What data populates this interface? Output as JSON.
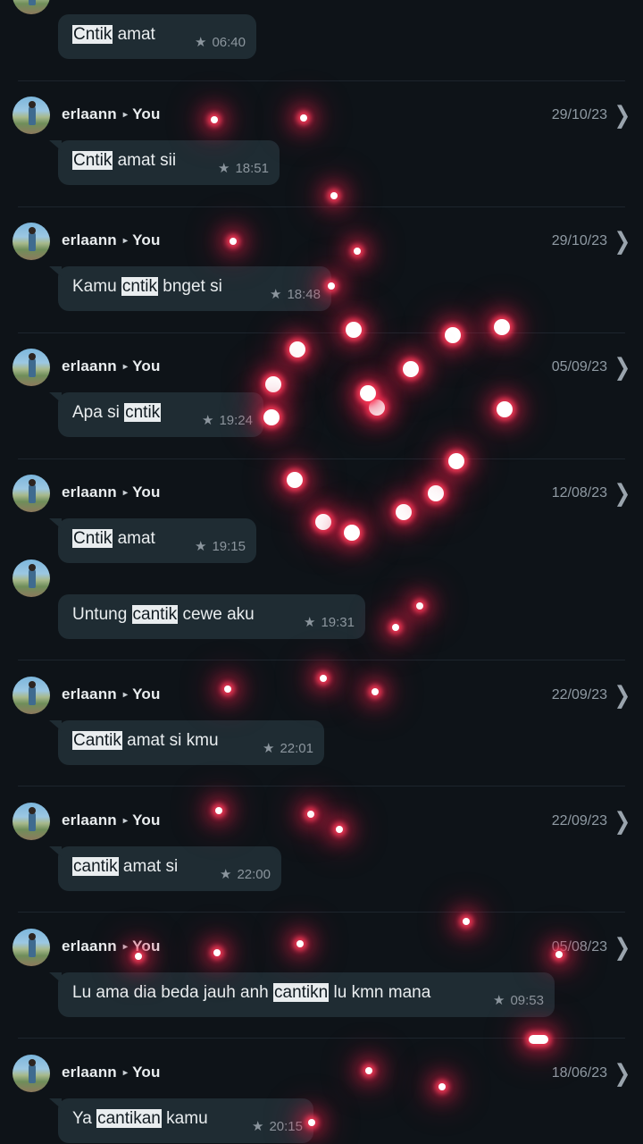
{
  "results": [
    {
      "sender": "",
      "recipient": "",
      "date": "",
      "show_header": false,
      "message_parts": [
        {
          "text": "Cntik",
          "highlight": true
        },
        {
          "text": " amat",
          "highlight": false
        }
      ],
      "starred": true,
      "time": "06:40"
    },
    {
      "sender": "erlaann",
      "recipient": "You",
      "date": "29/10/23",
      "show_header": true,
      "message_parts": [
        {
          "text": "Cntik",
          "highlight": true
        },
        {
          "text": " amat sii",
          "highlight": false
        }
      ],
      "starred": true,
      "time": "18:51"
    },
    {
      "sender": "erlaann",
      "recipient": "You",
      "date": "29/10/23",
      "show_header": true,
      "message_parts": [
        {
          "text": "Kamu ",
          "highlight": false
        },
        {
          "text": "cntik",
          "highlight": true
        },
        {
          "text": " bnget si",
          "highlight": false
        }
      ],
      "starred": true,
      "time": "18:48"
    },
    {
      "sender": "erlaann",
      "recipient": "You",
      "date": "05/09/23",
      "show_header": true,
      "message_parts": [
        {
          "text": "Apa si ",
          "highlight": false
        },
        {
          "text": "cntik",
          "highlight": true
        }
      ],
      "starred": true,
      "time": "19:24"
    },
    {
      "sender": "erlaann",
      "recipient": "You",
      "date": "12/08/23",
      "show_header": true,
      "message_parts": [
        {
          "text": "Cntik",
          "highlight": true
        },
        {
          "text": " amat",
          "highlight": false
        }
      ],
      "starred": true,
      "time": "19:15"
    },
    {
      "sender": "",
      "recipient": "",
      "date": "",
      "show_header": false,
      "message_parts": [
        {
          "text": "Untung ",
          "highlight": false
        },
        {
          "text": "cantik",
          "highlight": true
        },
        {
          "text": " cewe aku",
          "highlight": false
        }
      ],
      "starred": true,
      "time": "19:31"
    },
    {
      "sender": "erlaann",
      "recipient": "You",
      "date": "22/09/23",
      "show_header": true,
      "message_parts": [
        {
          "text": "Cantik",
          "highlight": true
        },
        {
          "text": " amat si kmu",
          "highlight": false
        }
      ],
      "starred": true,
      "time": "22:01"
    },
    {
      "sender": "erlaann",
      "recipient": "You",
      "date": "22/09/23",
      "show_header": true,
      "message_parts": [
        {
          "text": "cantik",
          "highlight": true
        },
        {
          "text": " amat si",
          "highlight": false
        }
      ],
      "starred": true,
      "time": "22:00"
    },
    {
      "sender": "erlaann",
      "recipient": "You",
      "date": "05/08/23",
      "show_header": true,
      "message_parts": [
        {
          "text": "Lu ama dia beda jauh anh ",
          "highlight": false
        },
        {
          "text": "cantikn",
          "highlight": true
        },
        {
          "text": " lu kmn mana",
          "highlight": false
        }
      ],
      "starred": true,
      "time": "09:53"
    },
    {
      "sender": "erlaann",
      "recipient": "You",
      "date": "18/06/23",
      "show_header": true,
      "message_parts": [
        {
          "text": "Ya ",
          "highlight": false
        },
        {
          "text": "cantikan",
          "highlight": true
        },
        {
          "text": " kamu",
          "highlight": false
        }
      ],
      "starred": true,
      "time": "20:15"
    }
  ],
  "icons": {
    "star": "star-icon",
    "chevron": "chevron-right-icon",
    "forward_arrow": "arrow-right-icon"
  },
  "colors": {
    "background": "#0e1318",
    "bubble": "#1f2c33",
    "text": "#e9edef",
    "meta": "#8c969e",
    "highlight_bg": "#e9edef",
    "highlight_fg": "#111b21",
    "glow": "#e62048"
  }
}
